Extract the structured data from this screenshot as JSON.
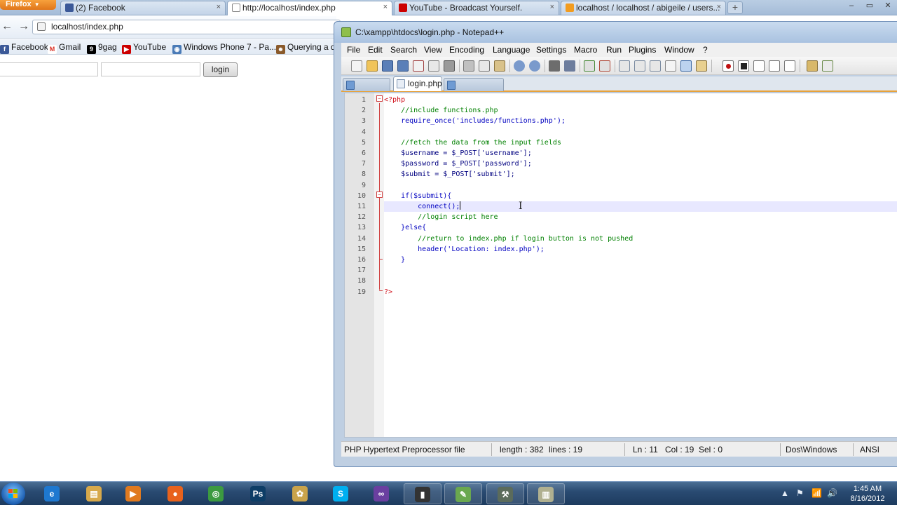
{
  "browser": {
    "menu_button": "Firefox",
    "menu_arrow": "▼",
    "tabs": [
      {
        "label": "(2) Facebook",
        "icon": "facebook-icon",
        "color": "#3b5998"
      },
      {
        "label": "http://localhost/index.php",
        "icon": "blank-page-icon",
        "color": "#ffffff"
      },
      {
        "label": "YouTube - Broadcast Yourself.",
        "icon": "youtube-icon",
        "color": "#cc0000"
      },
      {
        "label": "localhost / localhost / abigeile / users...",
        "icon": "phpmyadmin-icon",
        "color": "#f29c1f"
      }
    ],
    "tab_close": "×",
    "new_tab": "+",
    "window_controls": {
      "minimize": "–",
      "maximize": "▭",
      "close": "✕"
    },
    "nav": {
      "back": "←",
      "forward": "→"
    },
    "url": "localhost/index.php",
    "bookmarks": [
      {
        "label": "Facebook",
        "icon": "facebook-icon",
        "glyph": "f",
        "color": "#3b5998"
      },
      {
        "label": "Gmail",
        "icon": "gmail-icon",
        "glyph": "M",
        "color": "#d93025"
      },
      {
        "label": "9gag",
        "icon": "9gag-icon",
        "glyph": "9",
        "color": "#000000"
      },
      {
        "label": "YouTube",
        "icon": "youtube-icon",
        "glyph": "▶",
        "color": "#cc0000"
      },
      {
        "label": "Windows Phone 7 - Pa...",
        "icon": "globe-icon",
        "glyph": "◉",
        "color": "#4a7bb7"
      },
      {
        "label": "Querying a d",
        "icon": "mozilla-icon",
        "glyph": "☻",
        "color": "#8a5a2b"
      }
    ],
    "page": {
      "username_value": "",
      "password_value": "",
      "login_button": "login"
    }
  },
  "npp": {
    "title": "C:\\xampp\\htdocs\\login.php - Notepad++",
    "menu": [
      "File",
      "Edit",
      "Search",
      "View",
      "Encoding",
      "Language",
      "Settings",
      "Macro",
      "Run",
      "Plugins",
      "Window",
      "?"
    ],
    "tabs": [
      {
        "label": "",
        "active": false
      },
      {
        "label": "login.php",
        "active": true
      },
      {
        "label": "",
        "active": false
      }
    ],
    "code_lines": [
      {
        "n": "1",
        "text": "<?php",
        "cls": "tok-php"
      },
      {
        "n": "2",
        "text": "    //include functions.php",
        "cls": "tok-cmt"
      },
      {
        "n": "3",
        "text": "    require_once('includes/functions.php');",
        "cls": "tok-kw"
      },
      {
        "n": "4",
        "text": "",
        "cls": ""
      },
      {
        "n": "5",
        "text": "    //fetch the data from the input fields",
        "cls": "tok-cmt"
      },
      {
        "n": "6",
        "text": "    $username = $_POST['username'];",
        "cls": "tok-var"
      },
      {
        "n": "7",
        "text": "    $password = $_POST['password'];",
        "cls": "tok-var"
      },
      {
        "n": "8",
        "text": "    $submit = $_POST['submit'];",
        "cls": "tok-var"
      },
      {
        "n": "9",
        "text": "",
        "cls": ""
      },
      {
        "n": "10",
        "text": "    if($submit){",
        "cls": "tok-kw"
      },
      {
        "n": "11",
        "text": "        connect();",
        "cls": "tok-kw"
      },
      {
        "n": "12",
        "text": "        //login script here",
        "cls": "tok-cmt"
      },
      {
        "n": "13",
        "text": "    }else{",
        "cls": "tok-kw"
      },
      {
        "n": "14",
        "text": "        //return to index.php if login button is not pushed",
        "cls": "tok-cmt"
      },
      {
        "n": "15",
        "text": "        header('Location: index.php');",
        "cls": "tok-kw"
      },
      {
        "n": "16",
        "text": "    }",
        "cls": "tok-kw"
      },
      {
        "n": "17",
        "text": "",
        "cls": ""
      },
      {
        "n": "18",
        "text": "",
        "cls": ""
      },
      {
        "n": "19",
        "text": "?>",
        "cls": "tok-php"
      }
    ],
    "current_line": 11,
    "status": {
      "filetype": "PHP Hypertext Preprocessor file",
      "length": "length : 382",
      "lines": "lines : 19",
      "ln": "Ln : 11",
      "col": "Col : 19",
      "sel": "Sel : 0",
      "eol": "Dos\\Windows",
      "encoding": "ANSI"
    }
  },
  "taskbar": {
    "apps": [
      {
        "name": "internet-explorer-icon",
        "glyph": "e",
        "color": "#1e78d0"
      },
      {
        "name": "file-explorer-icon",
        "glyph": "▤",
        "color": "#d7a94b"
      },
      {
        "name": "media-player-icon",
        "glyph": "▶",
        "color": "#e07a1f"
      },
      {
        "name": "firefox-icon",
        "glyph": "●",
        "color": "#e8621c"
      },
      {
        "name": "chrome-icon",
        "glyph": "◎",
        "color": "#3c9a40"
      },
      {
        "name": "photoshop-icon",
        "glyph": "Ps",
        "color": "#0d3d66"
      },
      {
        "name": "paint-icon",
        "glyph": "✿",
        "color": "#c9a34b"
      },
      {
        "name": "skype-icon",
        "glyph": "S",
        "color": "#00aff0"
      },
      {
        "name": "visual-studio-icon",
        "glyph": "∞",
        "color": "#6a3fa0"
      },
      {
        "name": "phone-icon",
        "glyph": "▮",
        "color": "#333333"
      },
      {
        "name": "notepadpp-icon",
        "glyph": "✎",
        "color": "#6aa84f"
      },
      {
        "name": "tools-icon",
        "glyph": "⚒",
        "color": "#5b6b5b"
      },
      {
        "name": "folder-icon",
        "glyph": "▥",
        "color": "#b0b090"
      }
    ],
    "tray": {
      "show_hidden": "▲",
      "network": "📶",
      "flag": "⚑",
      "volume": "🔊"
    },
    "clock": {
      "time": "1:45 AM",
      "date": "8/16/2012"
    }
  }
}
